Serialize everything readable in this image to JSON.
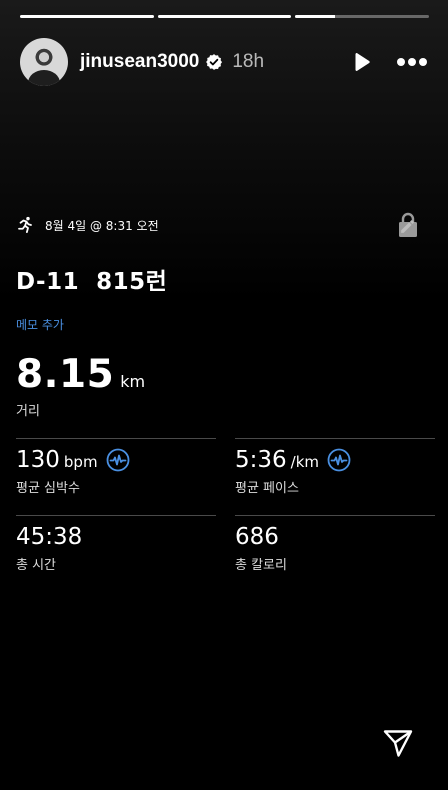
{
  "story": {
    "progress_segments": [
      1,
      1,
      0.3
    ]
  },
  "header": {
    "username": "jinusean3000",
    "verified": true,
    "time_ago": "18h",
    "icons": [
      "avatar",
      "verified-badge-icon",
      "play-icon",
      "more-icon"
    ]
  },
  "activity": {
    "date_text": "8월 4일 @ 8:31 오전",
    "title": "D-11  815런",
    "memo_link": "메모 추가",
    "distance": {
      "value": "8.15",
      "unit": "km",
      "label": "거리"
    },
    "stats": [
      {
        "value": "130",
        "unit": "bpm",
        "label": "평균 심박수",
        "has_pulse_icon": true
      },
      {
        "value": "5:36",
        "unit": "/km",
        "label": "평균 페이스",
        "has_pulse_icon": true
      },
      {
        "value": "45:38",
        "unit": "",
        "label": "총 시간",
        "has_pulse_icon": false
      },
      {
        "value": "686",
        "unit": "",
        "label": "총 칼로리",
        "has_pulse_icon": false
      }
    ]
  },
  "colors": {
    "accent_blue": "#4a90e2",
    "divider": "#4a4a4a",
    "background": "#000000"
  }
}
